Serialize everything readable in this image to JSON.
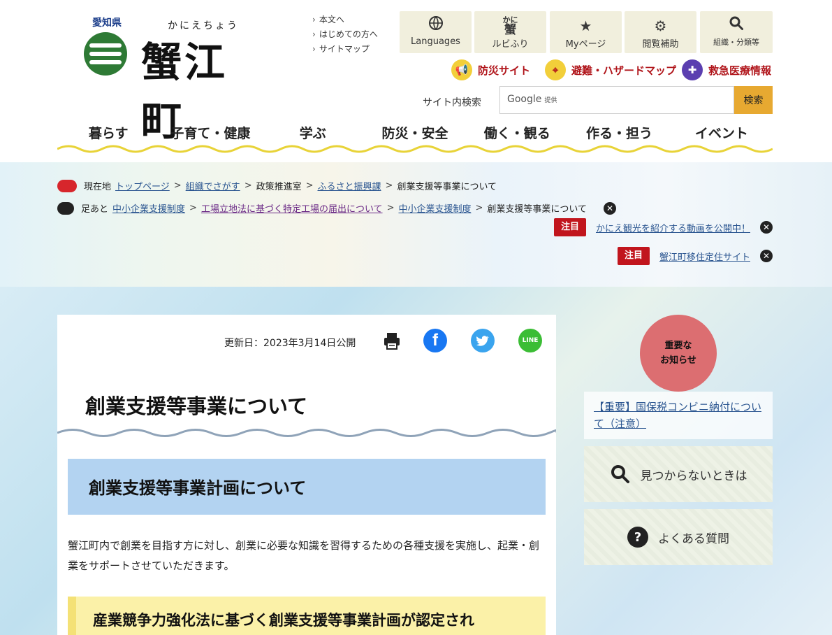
{
  "header": {
    "pref": "愛知県",
    "kana": "かにえちょう",
    "town_name": "蟹江町",
    "utility_links": [
      "本文へ",
      "はじめての方へ",
      "サイトマップ"
    ],
    "tools": [
      {
        "label": "Languages",
        "icon": "globe-icon",
        "glyph": "🌐"
      },
      {
        "label": "ルビふり",
        "icon": "ruby-icon",
        "glyph": "かに蟹"
      },
      {
        "label": "Myページ",
        "icon": "star-icon",
        "glyph": "★"
      },
      {
        "label": "閲覧補助",
        "icon": "gear-icon",
        "glyph": "⚙"
      },
      {
        "label": "組織・分類等",
        "icon": "search-icon",
        "glyph": "⚲"
      }
    ],
    "disaster_links": [
      {
        "label": "防災サイト",
        "icon": "megaphone-icon",
        "color": "#f2cf3a"
      },
      {
        "label": "避難・ハザードマップ",
        "icon": "map-icon",
        "color": "#f2cf3a"
      },
      {
        "label": "救急医療情報",
        "icon": "ambulance-icon",
        "color": "#5b3fb0"
      }
    ],
    "search": {
      "label": "サイト内検索",
      "provider": "Google",
      "provider_suffix": "提供",
      "button": "検索"
    },
    "accent_color": "#e7a931"
  },
  "global_nav": [
    "暮らす",
    "子育て・健康",
    "学ぶ",
    "防災・安全",
    "働く・観る",
    "作る・担う",
    "イベント"
  ],
  "breadcrumb": {
    "label": "現在地",
    "items": [
      {
        "text": "トップページ",
        "link": true
      },
      {
        "text": "組織でさがす",
        "link": true
      },
      {
        "text": "政策推進室",
        "link": false
      },
      {
        "text": "ふるさと振興課",
        "link": true
      },
      {
        "text": "創業支援等事業について",
        "link": false
      }
    ]
  },
  "footprints": {
    "label": "足あと",
    "items": [
      {
        "text": "中小企業支援制度",
        "link": true
      },
      {
        "text": "工場立地法に基づく特定工場の届出について",
        "link": true
      },
      {
        "text": "中小企業支援制度",
        "link": true
      },
      {
        "text": "創業支援等事業について",
        "link": false
      }
    ]
  },
  "notices": [
    {
      "tag": "注目",
      "text": "かにえ観光を紹介する動画を公開中！"
    },
    {
      "tag": "注目",
      "text": "蟹江町移住定住サイト"
    }
  ],
  "article": {
    "updated": "更新日：2023年3月14日公開",
    "title": "創業支援等事業について",
    "h2": "創業支援等事業計画について",
    "paragraph": "蟹江町内で創業を目指す方に対し、創業に必要な知識を習得するための各種支援を実施し、起業・創業をサポートさせていただきます。",
    "h3": "産業競争力強化法に基づく創業支援等事業計画が認定され"
  },
  "share": [
    {
      "name": "print-icon",
      "glyph": "⎙",
      "color": "#ffffff"
    },
    {
      "name": "facebook-icon",
      "glyph": "f",
      "color": "#1877f2"
    },
    {
      "name": "twitter-icon",
      "glyph": "t",
      "color": "#3aa4ee"
    },
    {
      "name": "line-icon",
      "glyph": "LINE",
      "color": "#3bbd35"
    }
  ],
  "sidebar": {
    "important_label": "重要な\nお知らせ",
    "important_link": "【重要】国保税コンビニ納付について（注意）",
    "not_found": "見つからないときは",
    "faq": "よくある質問"
  }
}
